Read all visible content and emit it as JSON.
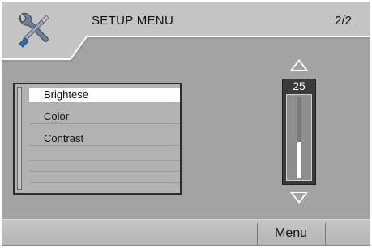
{
  "header": {
    "title": "SETUP MENU",
    "page_indicator": "2/2",
    "icon": "tools-icon"
  },
  "menu": {
    "selected_index": 0,
    "items": [
      {
        "label": "Brightese"
      },
      {
        "label": "Color"
      },
      {
        "label": "Contrast"
      }
    ]
  },
  "slider": {
    "value": "25",
    "fill_fraction": 0.45,
    "up_icon": "triangle-up-icon",
    "down_icon": "triangle-down-icon"
  },
  "footer": {
    "menu_label": "Menu"
  },
  "colors": {
    "background": "#a3a3a3",
    "highlight": "#ffffff",
    "icon_blue": "#2a6fb0"
  }
}
